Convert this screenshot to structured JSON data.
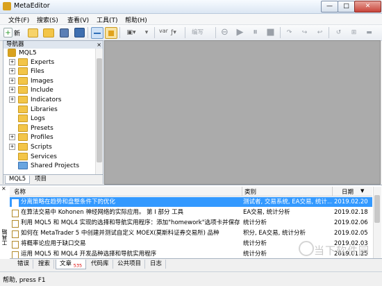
{
  "window": {
    "title": "MetaEditor",
    "min": "—",
    "max": "□",
    "close": "✕"
  },
  "menu": [
    "文件(F)",
    "搜索(S)",
    "查看(V)",
    "工具(T)",
    "帮助(H)"
  ],
  "toolbar": {
    "new_label": "新",
    "var_label": "var",
    "compile_label": "编写"
  },
  "navigator": {
    "title": "导航器",
    "close": "×",
    "root": "MQL5",
    "items": [
      "Experts",
      "Files",
      "Images",
      "Include",
      "Indicators",
      "Libraries",
      "Logs",
      "Presets",
      "Profiles",
      "Scripts",
      "Services",
      "Shared Projects"
    ],
    "tabs": [
      "MQL5",
      "项目"
    ]
  },
  "toolbox": {
    "columns": {
      "name": "名称",
      "category": "类别",
      "date": "日期"
    },
    "rows": [
      {
        "title": "分离策略在趋势和盘整条件下的优化",
        "category": "测试者, 交易系统, EA交易, 统计…",
        "date": "2019.02.20"
      },
      {
        "title": "在算法交易中 Kohonen 神经网络的实际应用。 第 I 部分 工具",
        "category": "EA交易, 统计分析",
        "date": "2019.02.18"
      },
      {
        "title": "利用 MQL5 和 MQL4 实现的选择和导航实用程序：添加\"homework\"选项卡并保存…",
        "category": "统计分析",
        "date": "2019.02.06"
      },
      {
        "title": "如何在 MetaTrader 5 中创建并测试自定义 MOEX(莫斯科证券交易所) 品种",
        "category": "积分, EA交易, 统计分析",
        "date": "2019.02.05"
      },
      {
        "title": "将概率论应用于缺口交易",
        "category": "统计分析",
        "date": "2019.02.03"
      },
      {
        "title": "运用 MQL5 和 MQL4 开发品种选择和导航实用程序",
        "category": "统计分析",
        "date": "2019.01.25"
      }
    ],
    "side_label": "工具箱",
    "tabs": [
      {
        "label": "错误"
      },
      {
        "label": "搜索"
      },
      {
        "label": "文章",
        "badge": "535"
      },
      {
        "label": "代码库"
      },
      {
        "label": "公共项目"
      },
      {
        "label": "日志"
      }
    ]
  },
  "status": {
    "text": "帮助, press F1"
  },
  "watermark": {
    "text": "当下软件园"
  }
}
